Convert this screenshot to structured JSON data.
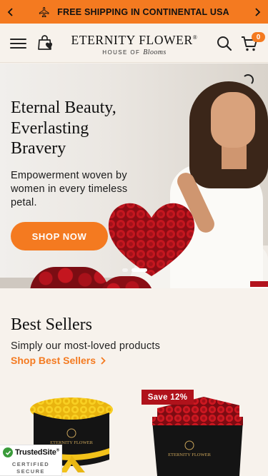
{
  "announcement": {
    "message": "FREE SHIPPING IN CONTINENTAL USA",
    "prev_icon": "chevron-left-icon",
    "next_icon": "chevron-right-icon",
    "plane_icon": "airplane-icon"
  },
  "header": {
    "logo_line1": "ETERNITY FLOWER",
    "logo_trademark": "®",
    "logo_line2_prefix": "HOUSE OF",
    "logo_line2_script": "Blooms",
    "cart_count": "0",
    "menu_icon": "hamburger-menu-icon",
    "wishlist_icon": "bag-heart-icon",
    "search_icon": "search-icon",
    "cart_icon": "cart-icon"
  },
  "hero": {
    "headline_line1": "Eternal Beauty,",
    "headline_line2": "Everlasting",
    "headline_line3": "Bravery",
    "subtext": "Empowerment woven by women in every timeless petal.",
    "cta_label": "SHOP NOW",
    "slide_count": 2,
    "active_slide": 2
  },
  "best_sellers": {
    "title": "Best Sellers",
    "subtitle": "Simply our most-loved products",
    "link_label": "Shop Best Sellers",
    "products": [
      {
        "brand_on_box": "ETERNITY FLOWER",
        "rose_color": "#f6c619",
        "badge": ""
      },
      {
        "brand_on_box": "ETERNITY FLOWER",
        "rose_color": "#c8141d",
        "badge": "Save 12%"
      }
    ]
  },
  "trust_badge": {
    "name": "TrustedSite",
    "trademark": "®",
    "line1": "CERTIFIED",
    "line2": "SECURE"
  },
  "colors": {
    "accent": "#f47a20",
    "background": "#f7f2ec",
    "badge_red": "#b0121b"
  }
}
